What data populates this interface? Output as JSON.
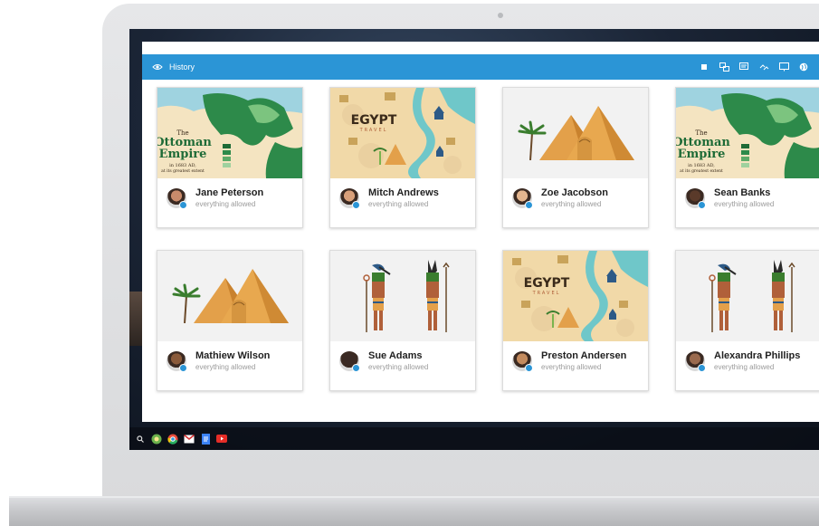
{
  "app": {
    "title": "History"
  },
  "toolbar": {
    "tools": [
      "stop-icon",
      "screens-icon",
      "message-icon",
      "link-icon",
      "present-icon",
      "web-icon",
      "block-icon"
    ]
  },
  "cards": [
    {
      "thumbnail": "ottoman-empire-map",
      "map_title": [
        "The",
        "Ottoman",
        "Empire"
      ],
      "map_caption": [
        "in 1683 AD,",
        "at its greatest extent"
      ],
      "name": "Jane Peterson",
      "status": "everything allowed"
    },
    {
      "thumbnail": "egypt-travel-map",
      "map_title": [
        "EGYPT"
      ],
      "map_caption": [
        "TRAVEL"
      ],
      "name": "Mitch Andrews",
      "status": "everything allowed"
    },
    {
      "thumbnail": "pyramids-sphinx",
      "name": "Zoe Jacobson",
      "status": "everything allowed"
    },
    {
      "thumbnail": "ottoman-empire-map",
      "map_title": [
        "The",
        "Ottoman",
        "Empire"
      ],
      "map_caption": [
        "in 1683 AD,",
        "at its greatest extent"
      ],
      "name": "Sean Banks",
      "status": "everything allowed"
    },
    {
      "thumbnail": "pyramids-sphinx",
      "name": "Mathiew Wilson",
      "status": "everything allowed"
    },
    {
      "thumbnail": "egyptian-gods",
      "name": "Sue Adams",
      "status": "everything allowed"
    },
    {
      "thumbnail": "egypt-travel-map",
      "map_title": [
        "EGYPT"
      ],
      "map_caption": [
        "TRAVEL"
      ],
      "name": "Preston Andersen",
      "status": "everything allowed"
    },
    {
      "thumbnail": "egyptian-gods",
      "name": "Alexandra Phillips",
      "status": "everything allowed"
    }
  ],
  "shelf": {
    "apps": [
      "search-icon",
      "classroom-icon",
      "chrome-icon",
      "gmail-icon",
      "docs-icon",
      "youtube-icon"
    ]
  },
  "colors": {
    "accent": "#2b95d6",
    "map_sand": "#f1d9a8",
    "nile": "#6fc7c9",
    "pyramid": "#e3a04a",
    "ottoman_green": "#2d8a4a"
  }
}
